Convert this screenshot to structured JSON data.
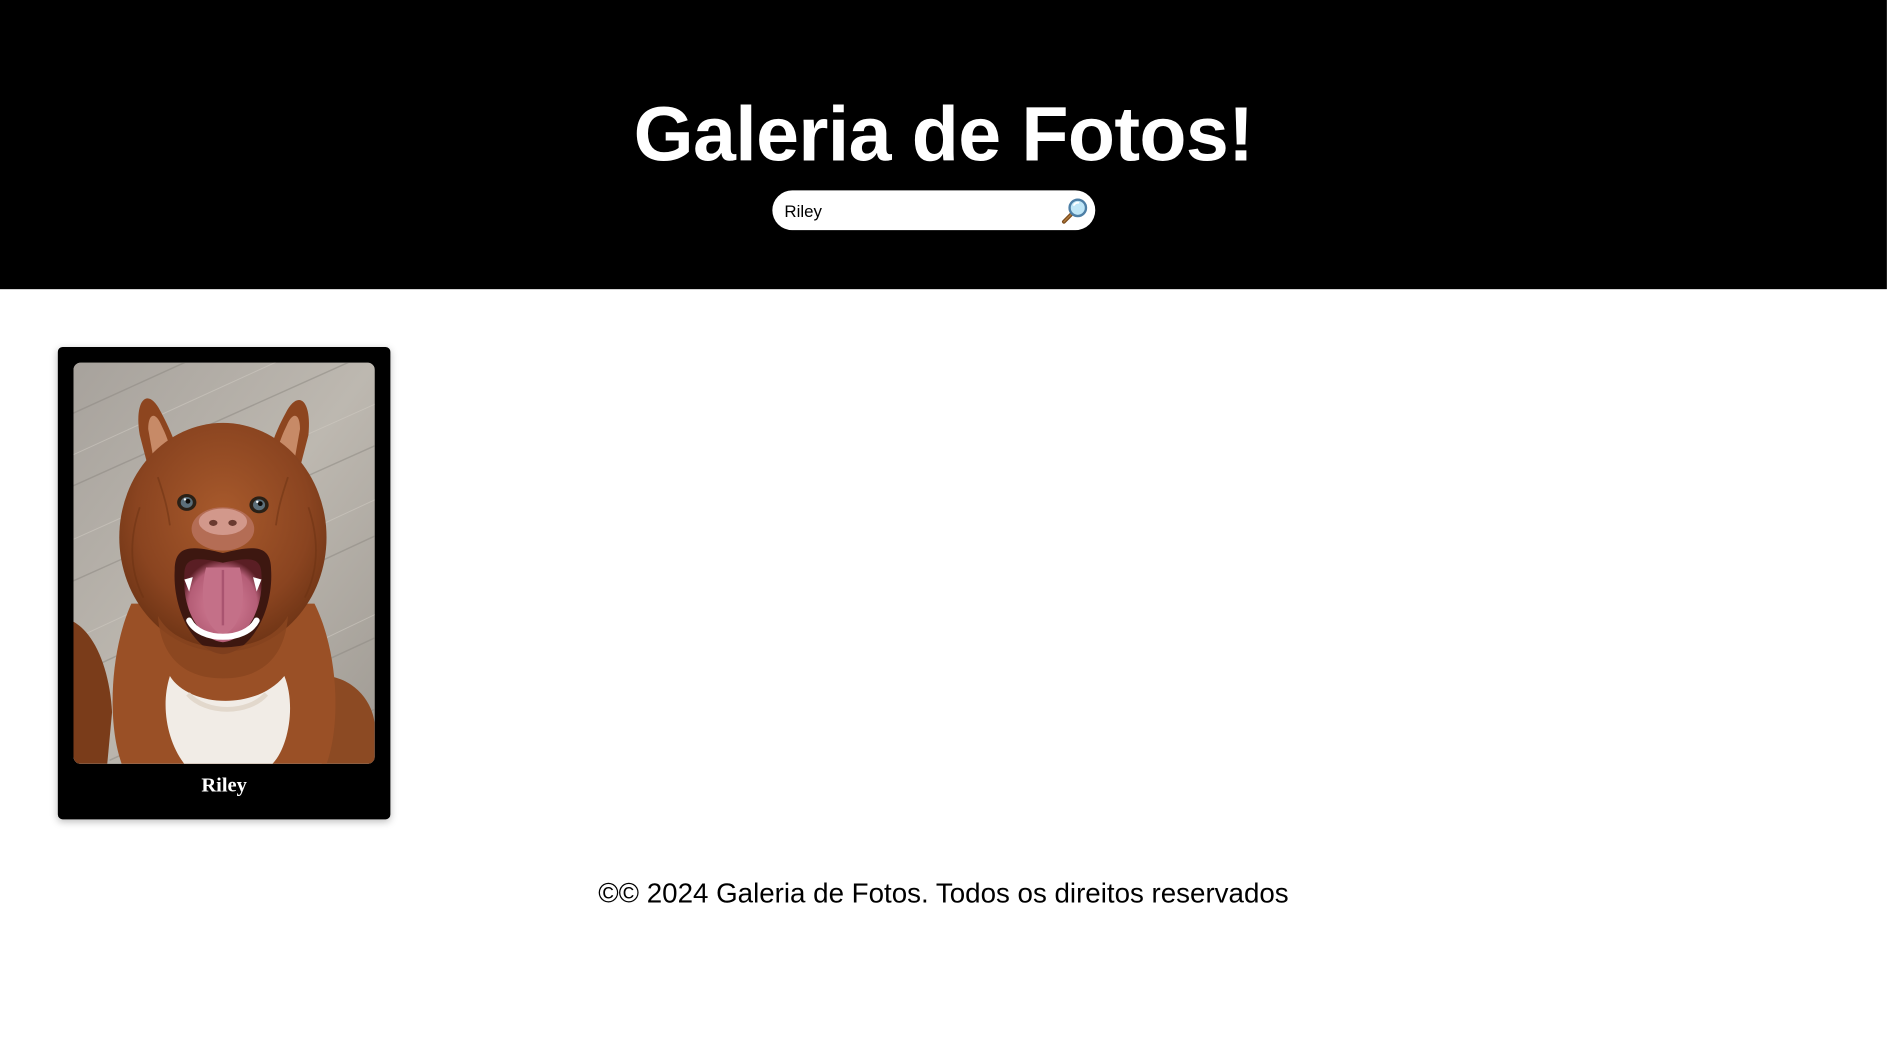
{
  "header": {
    "title": "Galeria de Fotos!",
    "background": "#000000",
    "title_color": "#ffffff"
  },
  "search": {
    "value": "Riley",
    "icon": "magnifying-glass-icon"
  },
  "gallery": {
    "items": [
      {
        "caption": "Riley",
        "image": "dog-photo"
      }
    ]
  },
  "footer": {
    "text": "©© 2024 Galeria de Fotos. Todos os direitos reservados"
  }
}
